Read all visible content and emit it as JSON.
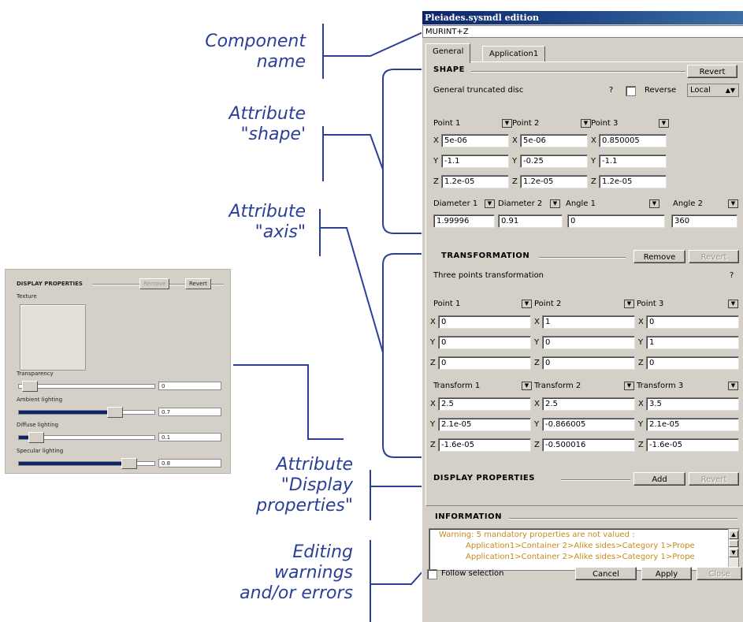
{
  "annotations": {
    "component_name": [
      "Component",
      "name"
    ],
    "attr_shape": [
      "Attribute",
      "\"shape'"
    ],
    "attr_axis": [
      "Attribute",
      "\"axis\""
    ],
    "attr_display": [
      "Attribute",
      "\"Display",
      "properties\""
    ],
    "editing": [
      "Editing",
      "warnings",
      "and/or errors"
    ]
  },
  "mini_panel": {
    "title": "DISPLAY PROPERTIES",
    "remove_label": "Remove",
    "revert_label": "Revert",
    "texture_label": "Texture",
    "sliders": [
      {
        "label": "Transparency",
        "value": "0",
        "level": 0.05
      },
      {
        "label": "Ambient lighting",
        "value": "0.7",
        "level": 0.7
      },
      {
        "label": "Diffuse lighting",
        "value": "0.1",
        "level": 0.1
      },
      {
        "label": "Specular lighting",
        "value": "0.8",
        "level": 0.8
      }
    ]
  },
  "dialog": {
    "title": "Pleiades.sysmdl edition",
    "component_name": "MURINT+Z",
    "tabs": [
      "General",
      "Application1"
    ],
    "shape": {
      "section": "SHAPE",
      "revert_label": "Revert",
      "type": "General truncated disc",
      "help": "?",
      "reverse_label": "Reverse",
      "frame": "Local",
      "points": [
        {
          "label": "Point 1",
          "x": "5e-06",
          "y": "-1.1",
          "z": "1.2e-05"
        },
        {
          "label": "Point 2",
          "x": "5e-06",
          "y": "-0.25",
          "z": "1.2e-05"
        },
        {
          "label": "Point 3",
          "x": "0.850005",
          "y": "-1.1",
          "z": "1.2e-05"
        }
      ],
      "params": [
        {
          "label": "Diameter 1",
          "value": "1.99996"
        },
        {
          "label": "Diameter 2",
          "value": "0.91"
        },
        {
          "label": "Angle 1",
          "value": "0"
        },
        {
          "label": "Angle 2",
          "value": "360"
        }
      ]
    },
    "transformation": {
      "section": "TRANSFORMATION",
      "remove_label": "Remove",
      "revert_label": "Revert",
      "type": "Three points transformation",
      "help": "?",
      "points": [
        {
          "label": "Point 1",
          "x": "0",
          "y": "0",
          "z": "0"
        },
        {
          "label": "Point 2",
          "x": "1",
          "y": "0",
          "z": "0"
        },
        {
          "label": "Point 3",
          "x": "0",
          "y": "1",
          "z": "0"
        }
      ],
      "transforms": [
        {
          "label": "Transform 1",
          "x": "2.5",
          "y": "2.1e-05",
          "z": "-1.6e-05"
        },
        {
          "label": "Transform 2",
          "x": "2.5",
          "y": "-0.866005",
          "z": "-0.500016"
        },
        {
          "label": "Transform 3",
          "x": "3.5",
          "y": "2.1e-05",
          "z": "-1.6e-05"
        }
      ]
    },
    "display": {
      "section": "DISPLAY PROPERTIES",
      "add_label": "Add",
      "revert_label": "Revert"
    },
    "information": {
      "section": "INFORMATION",
      "lines": [
        "Warning: 5 mandatory properties are not valued :",
        "Application1>Container 2>Alike sides>Category 1>Prope",
        "Application1>Container 2>Alike sides>Category 1>Prope"
      ]
    },
    "footer": {
      "follow_label": "Follow selection",
      "cancel_label": "Cancel",
      "apply_label": "Apply",
      "close_label": "Close"
    },
    "coord_labels": [
      "X",
      "Y",
      "Z"
    ]
  }
}
